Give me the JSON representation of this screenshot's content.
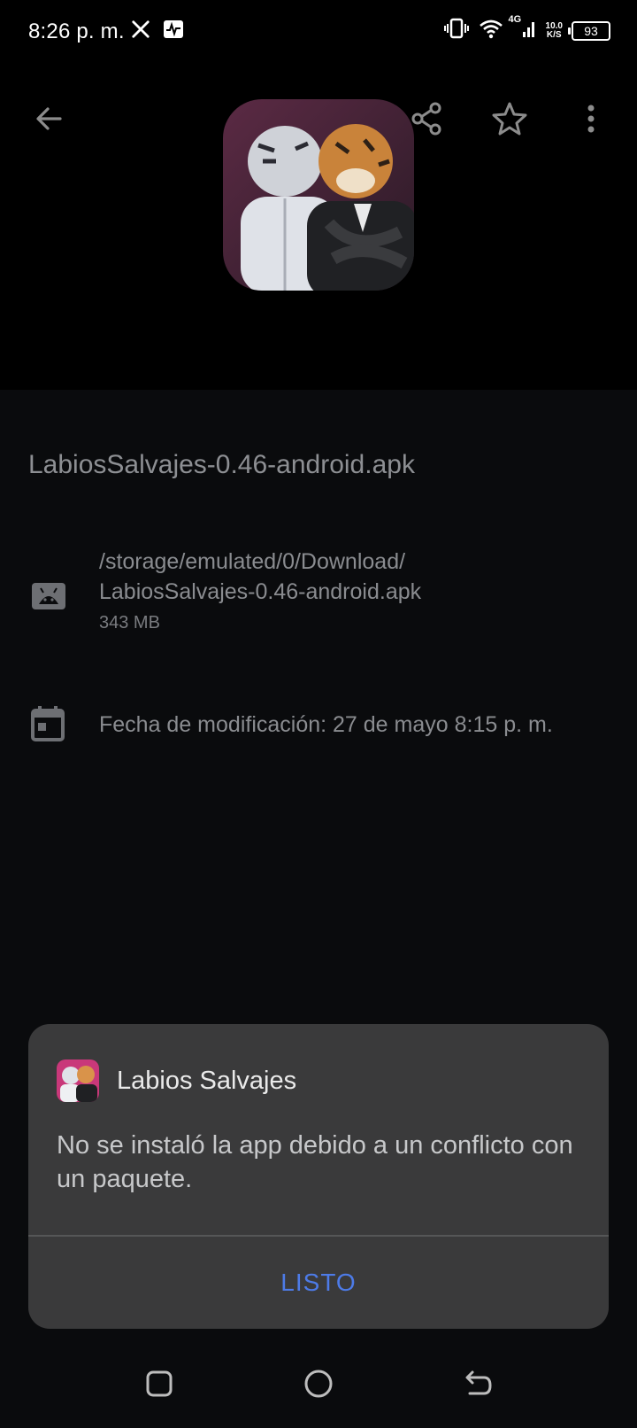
{
  "status_bar": {
    "time": "8:26 p. m.",
    "network_type": "4G",
    "net_speed_value": "10.0",
    "net_speed_unit": "K/S",
    "battery_level": "93",
    "icons": [
      "x-app-icon",
      "activity-icon",
      "vibrate-icon",
      "wifi-icon",
      "signal-icon",
      "battery-icon"
    ]
  },
  "toolbar": {
    "icons": [
      "back-arrow-icon",
      "share-icon",
      "star-icon",
      "more-vert-icon"
    ]
  },
  "file": {
    "name": "LabiosSalvajes-0.46-android.apk",
    "path_line1": "/storage/emulated/0/Download/",
    "path_line2": "LabiosSalvajes-0.46-android.apk",
    "size": "343 MB",
    "modified": "Fecha de modificación: 27 de mayo 8:15 p. m."
  },
  "dialog": {
    "app_name": "Labios Salvajes",
    "message": "No se instaló la app debido a un conflicto con un paquete.",
    "button_label": "LISTO",
    "accent_color": "#4d7be8"
  },
  "nav_bar": {
    "icons": [
      "recents-square-icon",
      "home-circle-icon",
      "back-nav-icon"
    ]
  }
}
